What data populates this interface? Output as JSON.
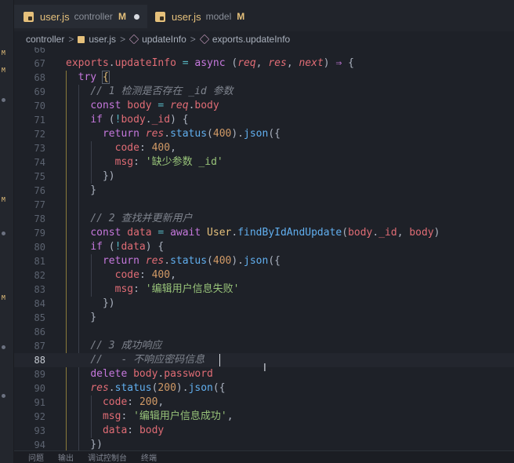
{
  "tabs": [
    {
      "name": "user.js",
      "dir": "controller",
      "status": "M",
      "modified_dot": true
    },
    {
      "name": "user.js",
      "dir": "model",
      "status": "M",
      "modified_dot": false
    }
  ],
  "breadcrumb": {
    "folder": "controller",
    "file": "user.js",
    "symbol1": "updateInfo",
    "symbol2": "exports.updateInfo"
  },
  "editor": {
    "current_line": "88",
    "line_numbers": [
      "66",
      "67",
      "68",
      "69",
      "70",
      "71",
      "72",
      "73",
      "74",
      "75",
      "76",
      "77",
      "78",
      "79",
      "80",
      "81",
      "82",
      "83",
      "84",
      "85",
      "86",
      "87",
      "88",
      "89",
      "90",
      "91",
      "92",
      "93",
      "94"
    ],
    "comments": {
      "c69": "// 1 检测是否存在 _id 参数",
      "c78": "// 2 查找并更新用户",
      "c87": "// 3 成功响应",
      "c88": "//   - 不响应密码信息"
    },
    "strings": {
      "s74": "'缺少参数 _id'",
      "s83": "'编辑用户信息失败'",
      "s92": "'编辑用户信息成功'"
    },
    "numbers": {
      "n72": "400",
      "n73": "400",
      "n81": "400",
      "n82": "400",
      "n90": "200",
      "n91": "200"
    }
  },
  "bottom_panel": [
    "问题",
    "输出",
    "调试控制台",
    "终端"
  ],
  "colors": {
    "background": "#1e2128",
    "keyword": "#c678dd",
    "function": "#61afef",
    "string": "#98c379",
    "comment": "#7f848e",
    "number": "#d19a66",
    "variable": "#e06c75",
    "class": "#e5c07b"
  }
}
